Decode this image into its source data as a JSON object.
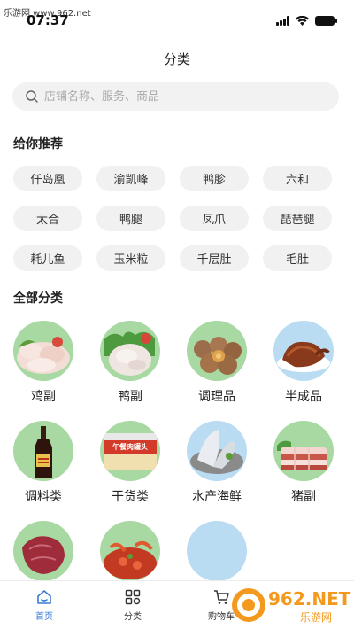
{
  "watermark": "乐游网 www.962.net",
  "status": {
    "time": "07:37"
  },
  "header": {
    "title": "分类"
  },
  "search": {
    "placeholder": "店铺名称、服务、商品"
  },
  "recommend": {
    "title": "给你推荐",
    "tags": [
      "仟岛凰",
      "渝凯峰",
      "鸭胗",
      "六和",
      "太合",
      "鸭腿",
      "凤爪",
      "琵琶腿",
      "耗儿鱼",
      "玉米粒",
      "千层肚",
      "毛肚"
    ]
  },
  "categories": {
    "title": "全部分类",
    "items": [
      {
        "label": "鸡副",
        "bg": "#a8d9a3"
      },
      {
        "label": "鸭副",
        "bg": "#a8d9a3"
      },
      {
        "label": "调理品",
        "bg": "#a8d9a3"
      },
      {
        "label": "半成品",
        "bg": "#b9dcf2"
      },
      {
        "label": "调料类",
        "bg": "#a8d9a3"
      },
      {
        "label": "干货类",
        "bg": "#a8d9a3"
      },
      {
        "label": "水产海鲜",
        "bg": "#b9dcf2"
      },
      {
        "label": "猪副",
        "bg": "#a8d9a3"
      },
      {
        "label": "",
        "bg": "#a8d9a3"
      },
      {
        "label": "",
        "bg": "#a8d9a3"
      },
      {
        "label": "",
        "bg": "#b9dcf2"
      }
    ],
    "can_label": "午餐肉罐头"
  },
  "tabbar": {
    "items": [
      {
        "label": "首页",
        "icon": "home-icon",
        "active": true
      },
      {
        "label": "分类",
        "icon": "category-icon",
        "active": false
      },
      {
        "label": "购物车",
        "icon": "cart-icon",
        "active": false
      }
    ]
  },
  "badge": {
    "text": "962.NET",
    "sub": "乐游网"
  },
  "colors": {
    "accent": "#3a7bd5",
    "tag_bg": "#f1f1f1",
    "badge_orange": "#f39a1e"
  }
}
